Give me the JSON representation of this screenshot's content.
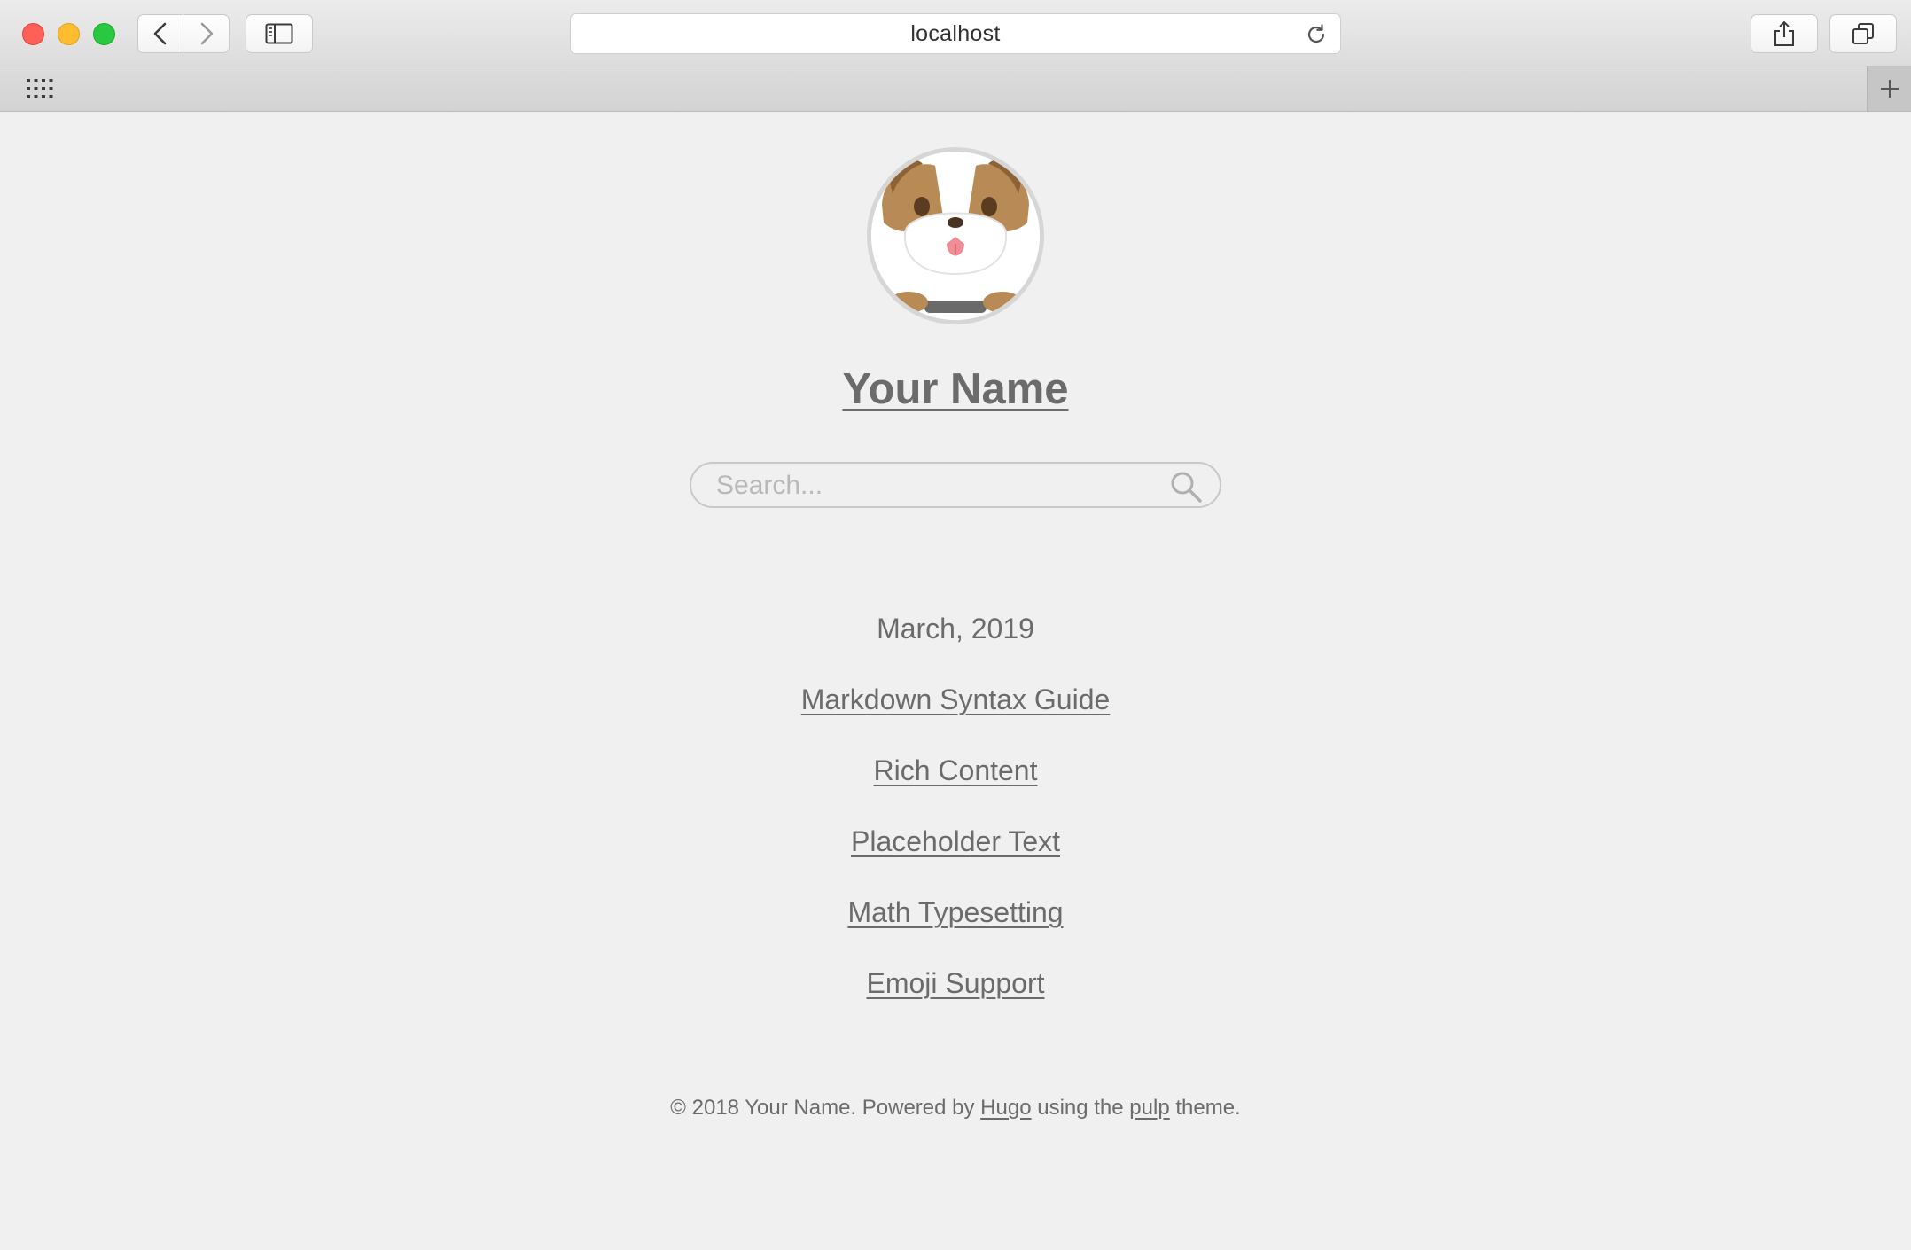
{
  "browser": {
    "url": "localhost",
    "icons": {
      "back": "chevron-left-icon",
      "forward": "chevron-right-icon",
      "sidebar": "sidebar-icon",
      "reload": "reload-icon",
      "share": "share-icon",
      "tabs": "tabs-overview-icon",
      "favorites": "grid-icon",
      "new_tab": "plus-icon"
    }
  },
  "site": {
    "title": "Your Name",
    "avatar": "bulldog-avatar",
    "search": {
      "placeholder": "Search...",
      "value": ""
    }
  },
  "archive": {
    "month": "March, 2019",
    "posts": [
      "Markdown Syntax Guide",
      "Rich Content",
      "Placeholder Text",
      "Math Typesetting",
      "Emoji Support"
    ]
  },
  "footer": {
    "prefix": "© 2018 Your Name. Powered by ",
    "hugo_link": "Hugo",
    "middle": " using the ",
    "theme_link": "pulp",
    "suffix": " theme."
  },
  "colors": {
    "text": "#6b6b6b",
    "page_background": "#f0f0f0",
    "close": "#fe5f57",
    "minimize": "#febc2e",
    "zoom": "#28c840"
  }
}
